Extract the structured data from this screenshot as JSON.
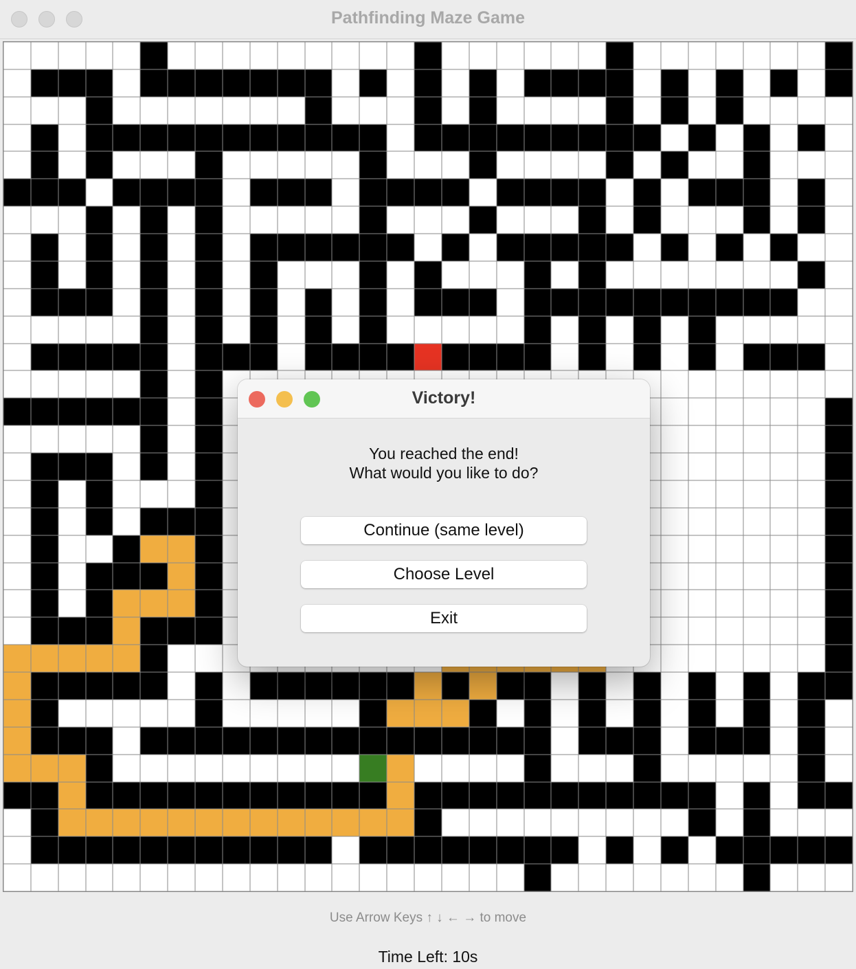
{
  "window": {
    "title": "Pathfinding Maze Game"
  },
  "maze": {
    "cols": 31,
    "rows": 31,
    "legend": {
      "#": "wall",
      ".": "open",
      "o": "path",
      "R": "start",
      "G": "end"
    },
    "grid": [
      ".....#.........#......#.......#......",
      ".###.#######.#.#.#.####.#.#.#.##",
      "...#.......#...#.#....#.#.#...",
      ".#.###########.#########.#.#.#.",
      ".#.#...#.....#...#....#.#..#.",
      "###.####.###.####.####.#.###.#.",
      "...#.#.#.....#...#...#.#...#.#.",
      ".#.#.#.#.######.#.#####.#.#.#.",
      ".#.#.#.#.#...#.#...#.#.......#.",
      ".###.#.#.#.#.#.###.##########.",
      ".....#.#.#.#.#.....#.#.#.#....",
      ".#####.###.####R####.#.#.#.###.",
      ".....#.#........................",
      "######.#......................#",
      ".....#.#......................#.",
      ".###.#.#......................##",
      ".#.#...#......................#.",
      ".#.#.###......................#.",
      ".#..#oo#......................#.",
      ".#.###o#......................#.",
      ".#.#ooo#......................#.",
      ".###o###......................##",
      "ooooo#..........oooooo........#.",
      "o#####.#.######o#o##.#.#.#.#.##",
      "o#.....#.....#ooo#.#.#.#.#.#.#.",
      "o###.###############.###.###.#.",
      "ooo#.........Go....#...#.....#.",
      "##o###########o###########.#.##",
      ".#ooooooooooooo#.........#.#...#.",
      ".###########.########.#.#.#####.",
      "...................#.......#......"
    ]
  },
  "dialog": {
    "title": "Victory!",
    "message_line1": "You reached the end!",
    "message_line2": "What would you like to do?",
    "buttons": {
      "continue": "Continue (same level)",
      "choose_level": "Choose Level",
      "exit": "Exit"
    },
    "traffic_colors": {
      "close": "#ec6a5e",
      "minimize": "#f4bf4f",
      "zoom": "#61c554"
    }
  },
  "footer": {
    "hint": "Use Arrow Keys ↑ ↓ ← → to move",
    "timer": "Time Left: 10s"
  }
}
